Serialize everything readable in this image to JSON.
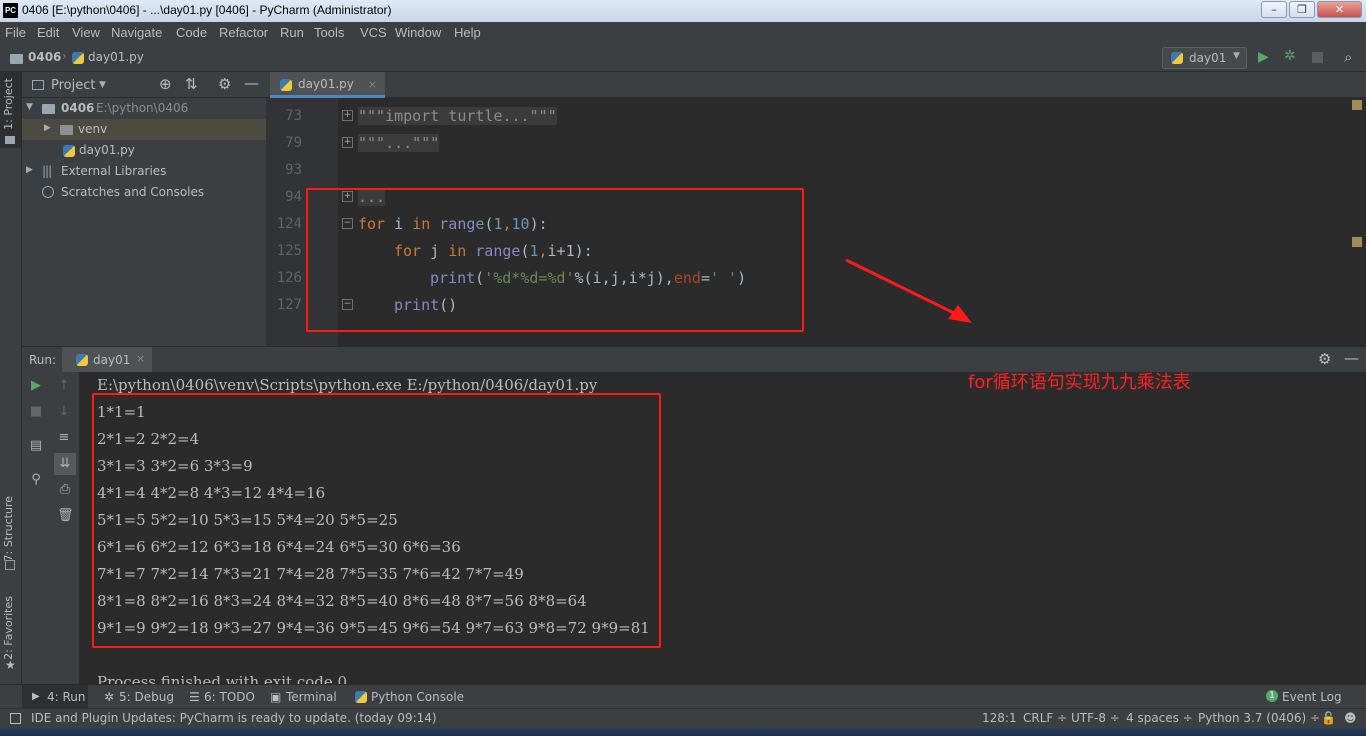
{
  "window": {
    "title": "0406 [E:\\python\\0406] - ...\\day01.py [0406] - PyCharm (Administrator)",
    "logo_text": "PC"
  },
  "menu": [
    "File",
    "Edit",
    "View",
    "Navigate",
    "Code",
    "Refactor",
    "Run",
    "Tools",
    "VCS",
    "Window",
    "Help"
  ],
  "nav": {
    "crumb_project": "0406",
    "crumb_file": "day01.py",
    "run_config": "day01"
  },
  "left_stripe": {
    "project_tab": "1: Project",
    "structure_tab": "7: Structure",
    "favorites_tab": "2: Favorites"
  },
  "project_panel": {
    "header": "Project",
    "root_name": "0406",
    "root_path": "E:\\python\\0406",
    "venv": "venv",
    "file": "day01.py",
    "external": "External Libraries",
    "scratches": "Scratches and Consoles"
  },
  "editor": {
    "tab_label": "day01.py",
    "lines": [
      {
        "no": "73",
        "text": "\"\"\"import turtle...\"\"\""
      },
      {
        "no": "79",
        "text": "\"\"\"...\"\"\""
      },
      {
        "no": "93",
        "text": ""
      },
      {
        "no": "94",
        "text": "..."
      },
      {
        "no": "124",
        "kw1": "for",
        "v1": " i ",
        "kw2": "in",
        "fn": " range",
        "p1": "(",
        "n1": "1",
        "c1": ",",
        "n2": "10",
        "p2": "):"
      },
      {
        "no": "125",
        "kw1": "for",
        "v1": " j ",
        "kw2": "in",
        "fn": " range",
        "p1": "(",
        "n1": "1",
        "c1": ",",
        "rest": "i+1):"
      },
      {
        "no": "126",
        "fn": "print",
        "p1": "(",
        "str": "'%d*%d=%d'",
        "op": "%(i,j,i*j),",
        "kwarg": "end",
        "eq": "=",
        "str2": "' '",
        "p2": ")"
      },
      {
        "no": "127",
        "fn": "print",
        "p1": "()"
      }
    ]
  },
  "run_panel": {
    "label": "Run:",
    "tab": "day01",
    "command": "E:\\python\\0406\\venv\\Scripts\\python.exe E:/python/0406/day01.py",
    "output": [
      "1*1=1",
      "2*1=2 2*2=4",
      "3*1=3 3*2=6 3*3=9",
      "4*1=4 4*2=8 4*3=12 4*4=16",
      "5*1=5 5*2=10 5*3=15 5*4=20 5*5=25",
      "6*1=6 6*2=12 6*3=18 6*4=24 6*5=30 6*6=36",
      "7*1=7 7*2=14 7*3=21 7*4=28 7*5=35 7*6=42 7*7=49",
      "8*1=8 8*2=16 8*3=24 8*4=32 8*5=40 8*6=48 8*7=56 8*8=64",
      "9*1=9 9*2=18 9*3=27 9*4=36 9*5=45 9*6=54 9*7=63 9*8=72 9*9=81"
    ],
    "finished": "Process finished with exit code 0"
  },
  "annotation": "for循环语句实现九九乘法表",
  "bottom_tools": {
    "run": "4: Run",
    "debug": "5: Debug",
    "todo": "6: TODO",
    "terminal": "Terminal",
    "python_console": "Python Console",
    "event_log": "Event Log",
    "event_count": "1"
  },
  "status": {
    "message": "IDE and Plugin Updates: PyCharm is ready to update. (today 09:14)",
    "position": "128:1",
    "line_sep": "CRLF ÷",
    "encoding": "UTF-8 ÷",
    "indent": "4 spaces ÷",
    "interpreter": "Python 3.7 (0406) ÷"
  },
  "colors": {
    "accent": "#4a88c7",
    "highlight_box": "#ff1a1a",
    "run_green": "#59a869"
  }
}
